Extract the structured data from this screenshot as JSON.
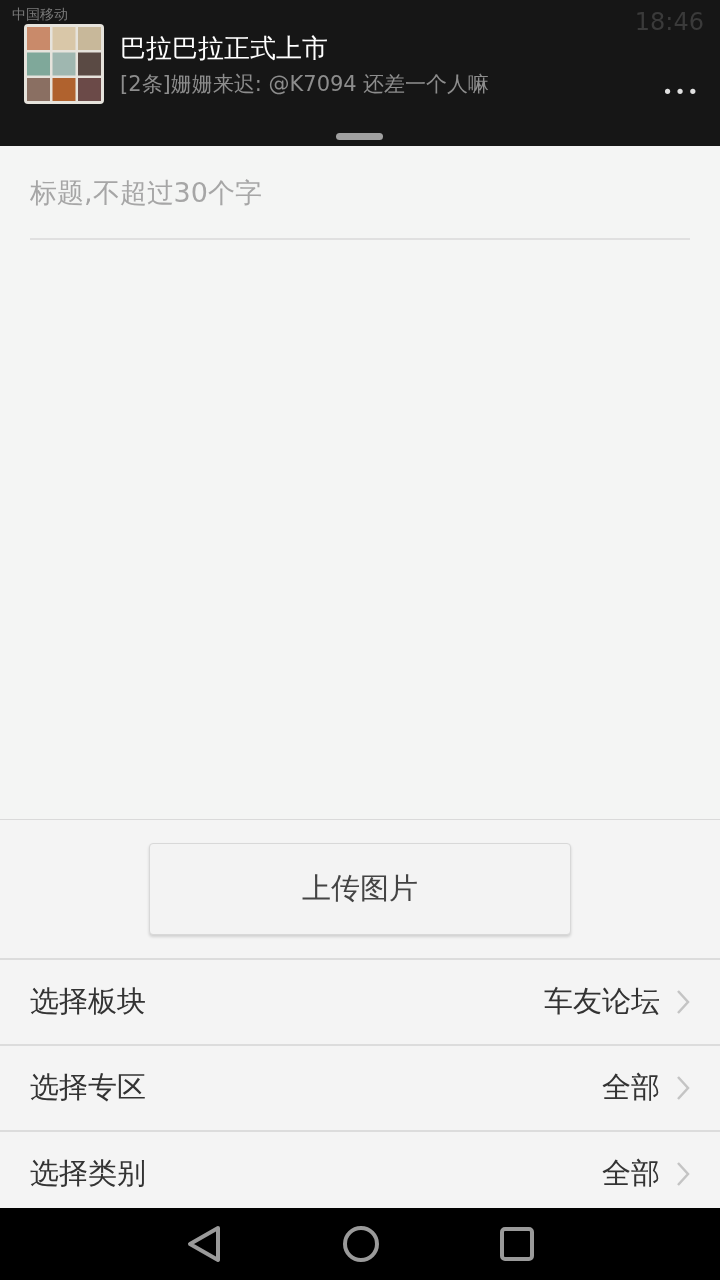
{
  "status_bar": {
    "carrier": "中国移动",
    "time": "18:46"
  },
  "notification": {
    "title": "巴拉巴拉正式上市",
    "message": "[2条]姗姗来迟: @K7094 还差一个人嘛",
    "more": "•••"
  },
  "title_field": {
    "placeholder": "标题,不超过30个字"
  },
  "upload_button": {
    "label": "上传图片"
  },
  "options": [
    {
      "label": "选择板块",
      "value": "车友论坛"
    },
    {
      "label": "选择专区",
      "value": "全部"
    },
    {
      "label": "选择类别",
      "value": "全部"
    }
  ]
}
